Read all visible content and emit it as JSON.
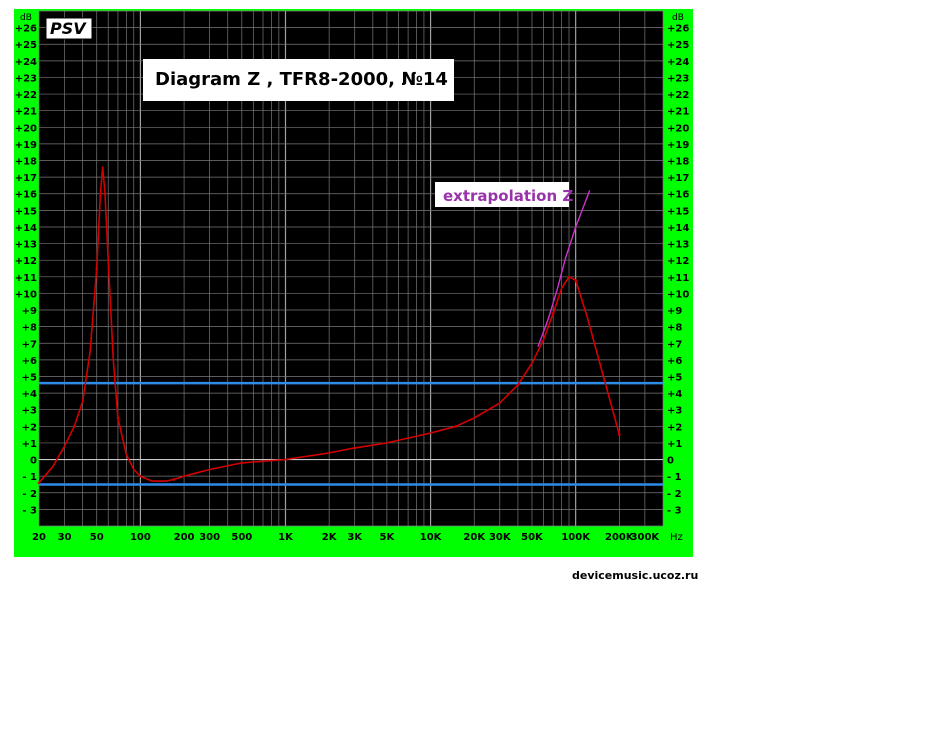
{
  "badge": "PSV",
  "title": "Diagram Z , TFR8-2000, №14",
  "annotation": "extrapolation Z",
  "watermark": "devicemusic.ucoz.ru",
  "colors": {
    "frame": "#00ff00",
    "plot_background": "#000000",
    "grid": "#7a7a7a",
    "curve": "#d40000",
    "extrapolation": "#cc33cc",
    "reference_lines": "#2e8be8",
    "zero_line": "#c8c8c8",
    "annotation_text": "#9933aa"
  },
  "chart_data": {
    "type": "line",
    "title": "Diagram Z , TFR8-2000, №14",
    "xscale": "log",
    "xlabel": "Hz",
    "ylabel": "dB",
    "xlim": [
      20,
      400000
    ],
    "ylim": [
      -4,
      27
    ],
    "x_ticks": [
      {
        "value": 20,
        "label": "20"
      },
      {
        "value": 30,
        "label": "30"
      },
      {
        "value": 50,
        "label": "50"
      },
      {
        "value": 100,
        "label": "100"
      },
      {
        "value": 200,
        "label": "200"
      },
      {
        "value": 300,
        "label": "300"
      },
      {
        "value": 500,
        "label": "500"
      },
      {
        "value": 1000,
        "label": "1K"
      },
      {
        "value": 2000,
        "label": "2K"
      },
      {
        "value": 3000,
        "label": "3K"
      },
      {
        "value": 5000,
        "label": "5K"
      },
      {
        "value": 10000,
        "label": "10K"
      },
      {
        "value": 20000,
        "label": "20K"
      },
      {
        "value": 30000,
        "label": "30K"
      },
      {
        "value": 50000,
        "label": "50K"
      },
      {
        "value": 100000,
        "label": "100K"
      },
      {
        "value": 200000,
        "label": "200K"
      },
      {
        "value": 300000,
        "label": "300K"
      }
    ],
    "y_ticks": [
      {
        "value": 26,
        "label": "+26"
      },
      {
        "value": 25,
        "label": "+25"
      },
      {
        "value": 24,
        "label": "+24"
      },
      {
        "value": 23,
        "label": "+23"
      },
      {
        "value": 22,
        "label": "+22"
      },
      {
        "value": 21,
        "label": "+21"
      },
      {
        "value": 20,
        "label": "+20"
      },
      {
        "value": 19,
        "label": "+19"
      },
      {
        "value": 18,
        "label": "+18"
      },
      {
        "value": 17,
        "label": "+17"
      },
      {
        "value": 16,
        "label": "+16"
      },
      {
        "value": 15,
        "label": "+15"
      },
      {
        "value": 14,
        "label": "+14"
      },
      {
        "value": 13,
        "label": "+13"
      },
      {
        "value": 12,
        "label": "+12"
      },
      {
        "value": 11,
        "label": "+11"
      },
      {
        "value": 10,
        "label": "+10"
      },
      {
        "value": 9,
        "label": "+9"
      },
      {
        "value": 8,
        "label": "+8"
      },
      {
        "value": 7,
        "label": "+7"
      },
      {
        "value": 6,
        "label": "+6"
      },
      {
        "value": 5,
        "label": "+5"
      },
      {
        "value": 4,
        "label": "+4"
      },
      {
        "value": 3,
        "label": "+3"
      },
      {
        "value": 2,
        "label": "+2"
      },
      {
        "value": 1,
        "label": "+1"
      },
      {
        "value": 0,
        "label": "0"
      },
      {
        "value": -1,
        "label": "- 1"
      },
      {
        "value": -2,
        "label": "- 2"
      },
      {
        "value": -3,
        "label": "- 3"
      }
    ],
    "grid": true,
    "reference_lines": [
      4.6,
      -1.5
    ],
    "series": [
      {
        "color": "#d40000",
        "x": [
          20,
          25,
          30,
          35,
          40,
          45,
          50,
          53,
          55,
          57,
          60,
          65,
          70,
          80,
          90,
          100,
          120,
          150,
          170,
          200,
          300,
          500,
          1000,
          2000,
          3000,
          5000,
          10000,
          15000,
          20000,
          30000,
          40000,
          50000,
          60000,
          70000,
          80000,
          90000,
          100000,
          120000,
          150000,
          200000
        ],
        "y": [
          -1.4,
          -0.4,
          0.8,
          2.0,
          3.5,
          6.5,
          11.5,
          16.0,
          17.6,
          16.0,
          12.0,
          6.0,
          2.5,
          0.3,
          -0.6,
          -1.0,
          -1.3,
          -1.3,
          -1.2,
          -1.0,
          -0.6,
          -0.2,
          0.0,
          0.4,
          0.7,
          1.0,
          1.6,
          2.0,
          2.5,
          3.4,
          4.5,
          5.8,
          7.2,
          8.8,
          10.3,
          11.0,
          10.8,
          8.6,
          5.5,
          1.5
        ]
      },
      {
        "color": "#cc33cc",
        "x": [
          55000,
          65000,
          75000,
          85000,
          100000,
          125000
        ],
        "y": [
          6.8,
          8.5,
          10.3,
          12.1,
          14.0,
          16.2
        ]
      }
    ]
  }
}
